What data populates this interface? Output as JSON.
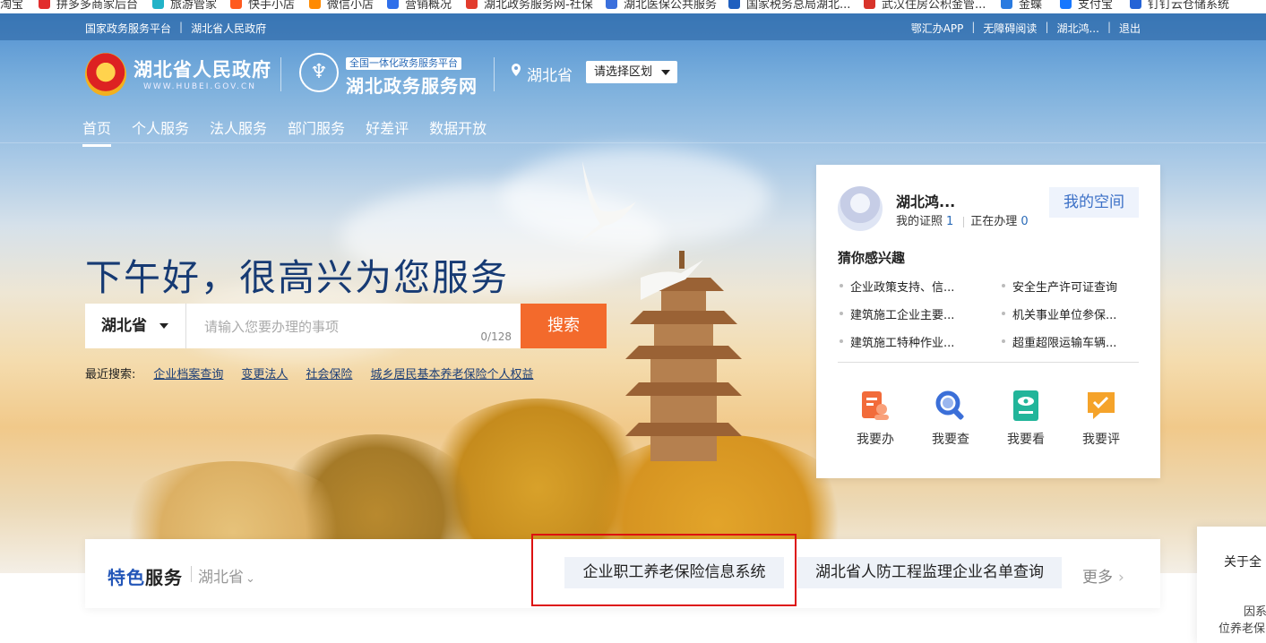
{
  "bookmarks": [
    {
      "label": "淘宝",
      "color": "#ff6a00"
    },
    {
      "label": "拼多多商家后台",
      "color": "#e22d2d"
    },
    {
      "label": "旅游管家",
      "color": "#22b3c8"
    },
    {
      "label": "快手小店",
      "color": "#ff5a1f"
    },
    {
      "label": "微信小店",
      "color": "#ff8a00"
    },
    {
      "label": "营销概况",
      "color": "#2f6fea"
    },
    {
      "label": "湖北政务服务网-社保",
      "color": "#e23c2d"
    },
    {
      "label": "湖北医保公共服务",
      "color": "#3a6fdc"
    },
    {
      "label": "国家税务总局湖北...",
      "color": "#1f5fbf"
    },
    {
      "label": "武汉住房公积金管...",
      "color": "#d8332a"
    },
    {
      "label": "金蝶",
      "color": "#2a7be0"
    },
    {
      "label": "支付宝",
      "color": "#1677ff"
    },
    {
      "label": "钉钉云仓储系统",
      "color": "#2463d6"
    }
  ],
  "top_strip": {
    "left_links": [
      "国家政务服务平台",
      "湖北省人民政府"
    ],
    "right_links": [
      "鄂汇办APP",
      "无障碍阅读",
      "湖北鸿...",
      "退出"
    ]
  },
  "header": {
    "gov_title": "湖北省人民政府",
    "gov_sub": "WWW.HUBEI.GOV.CN",
    "svc_tag": "全国一体化政务服务平台",
    "svc_title": "湖北政务服务网",
    "location": "湖北省",
    "region_select": "请选择区划"
  },
  "nav": [
    "首页",
    "个人服务",
    "法人服务",
    "部门服务",
    "好差评",
    "数据开放"
  ],
  "greeting": "下午好，很高兴为您服务",
  "search": {
    "province": "湖北省",
    "placeholder": "请输入您要办理的事项",
    "count": "0/128",
    "button": "搜索"
  },
  "recent": {
    "label": "最近搜索:",
    "items": [
      "企业档案查询",
      "变更法人",
      "社会保险",
      "城乡居民基本养老保险个人权益"
    ]
  },
  "user_card": {
    "name": "湖北鸿...",
    "cert_label": "我的证照",
    "cert_count": "1",
    "doing_label": "正在办理",
    "doing_count": "0",
    "my_space": "我的空间",
    "interest_title": "猜你感兴趣",
    "interests": [
      "企业政策支持、信...",
      "安全生产许可证查询",
      "建筑施工企业主要...",
      "机关事业单位参保...",
      "建筑施工特种作业...",
      "超重超限运输车辆..."
    ],
    "actions": [
      {
        "label": "我要办",
        "icon": "document-person-icon",
        "color": "#f26b3a"
      },
      {
        "label": "我要查",
        "icon": "magnifier-icon",
        "color": "#3b6fd8"
      },
      {
        "label": "我要看",
        "icon": "eye-screen-icon",
        "color": "#22b59a"
      },
      {
        "label": "我要评",
        "icon": "check-chat-icon",
        "color": "#f5a32a"
      }
    ]
  },
  "featured": {
    "label_a": "特色",
    "label_b": "服务",
    "region": "湖北省",
    "items": [
      "企业职工养老保险信息系统",
      "湖北省人防工程监理企业名单查询"
    ],
    "more": "更多"
  },
  "side_popup": {
    "line1": "关于全",
    "line2": "因系",
    "line3": "位养老保"
  }
}
